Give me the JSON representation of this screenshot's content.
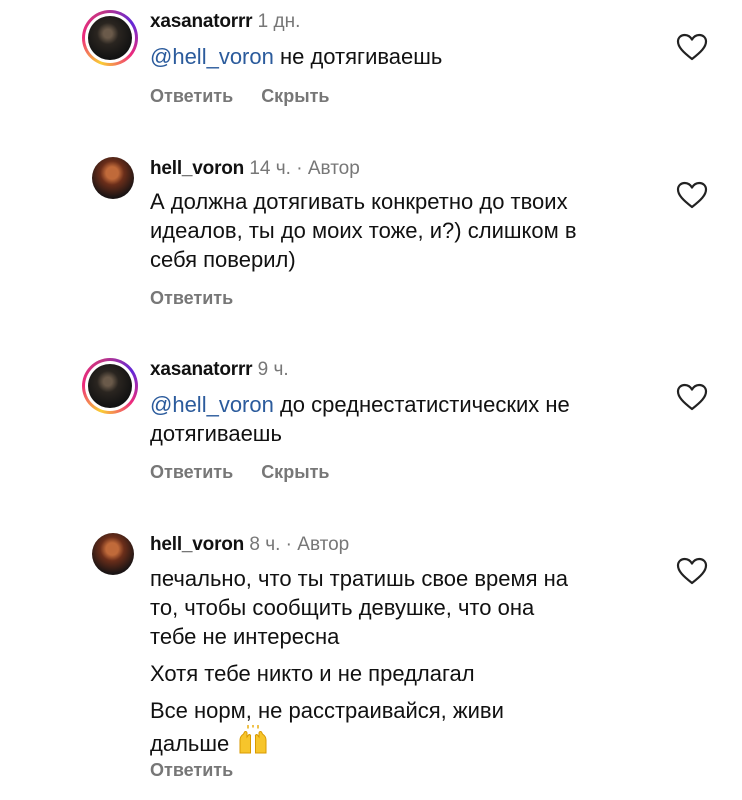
{
  "comments": [
    {
      "username": "xasanatorrr",
      "time": "1 дн.",
      "mention": "@hell_voron",
      "text": " не дотягиваешь",
      "reply_label": "Ответить",
      "hide_label": "Скрыть"
    },
    {
      "username": "hell_voron",
      "time": "14 ч.",
      "author_label": "· Автор",
      "text_lines": [
        "А должна дотягивать конкретно до твоих",
        "идеалов, ты до моих тоже, и?) слишком в",
        "себя поверил)"
      ],
      "reply_label": "Ответить"
    },
    {
      "username": "xasanatorrr",
      "time": "9 ч.",
      "mention": "@hell_voron",
      "text_first": " до среднестатистических не",
      "text_second": "дотягиваешь",
      "reply_label": "Ответить",
      "hide_label": "Скрыть"
    },
    {
      "username": "hell_voron",
      "time": "8 ч.",
      "author_label": "· Автор",
      "text_lines": [
        "печально, что ты тратишь свое время на",
        "то, чтобы сообщить девушке, что она",
        "тебе не интересна"
      ],
      "text_line2": "Хотя тебе никто и не предлагал",
      "text_line3a": "Все норм, не расстраивайся, живи",
      "text_line3b": "дальше",
      "emoji": "raising-hands-emoji",
      "reply_label": "Ответить"
    }
  ],
  "colors": {
    "mention": "#2b5b9c",
    "muted": "#777777",
    "text": "#111111"
  }
}
